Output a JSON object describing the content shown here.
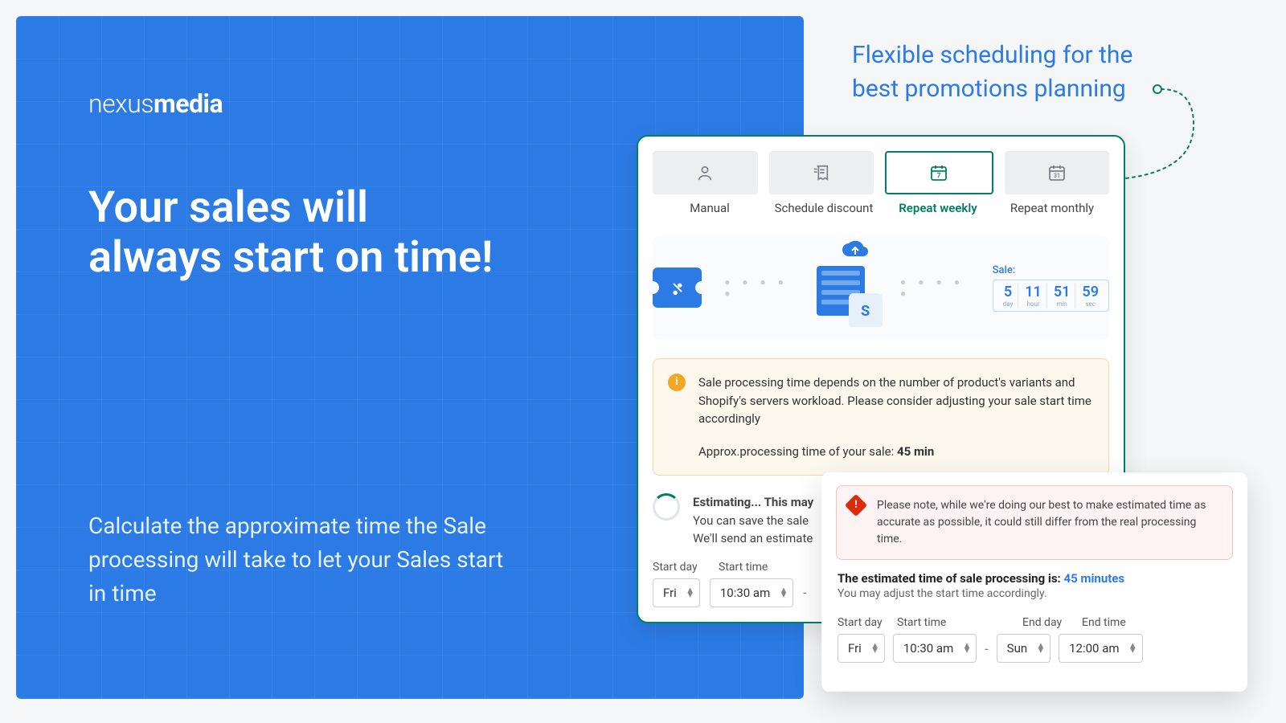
{
  "brand": {
    "part1": "nexus",
    "part2": "media"
  },
  "headline": "Your sales will always start on time!",
  "subline": "Calculate the approximate time the Sale processing will take to let your Sales start in time",
  "tagline": "Flexible scheduling for the best promotions planning",
  "tabs": {
    "manual": "Manual",
    "schedule": "Schedule discount",
    "weekly": "Repeat weekly",
    "monthly": "Repeat monthly"
  },
  "countdown": {
    "label": "Sale:",
    "day_n": "5",
    "day_u": "Day",
    "hour_n": "11",
    "hour_u": "Hour",
    "min_n": "51",
    "min_u": "Min",
    "sec_n": "59",
    "sec_u": "Sec"
  },
  "warning": {
    "body": "Sale processing time depends on the number of product's variants and Shopify's servers workload. Please consider adjusting your sale start time accordingly",
    "approx_label": "Approx.processing time of your sale: ",
    "approx_value": "45 min"
  },
  "estimating": {
    "heading": "Estimating... This may",
    "line2": "You can save the sale",
    "line3": "We'll send an estimate"
  },
  "schedule_a": {
    "start_day_label": "Start day",
    "start_time_label": "Start time",
    "start_day": "Fri",
    "start_time": "10:30 am"
  },
  "error_box": {
    "body": "Please note, while we're doing our best to make estimated time as accurate as possible, it could still differ from the real processing time."
  },
  "estimated": {
    "label": "The estimated time of sale processing is: ",
    "value": "45 minutes",
    "sub": "You may adjust the start time accordingly."
  },
  "schedule_b": {
    "start_day_label": "Start day",
    "start_time_label": "Start time",
    "end_day_label": "End day",
    "end_time_label": "End time",
    "start_day": "Fri",
    "start_time": "10:30 am",
    "end_day": "Sun",
    "end_time": "12:00 am"
  }
}
